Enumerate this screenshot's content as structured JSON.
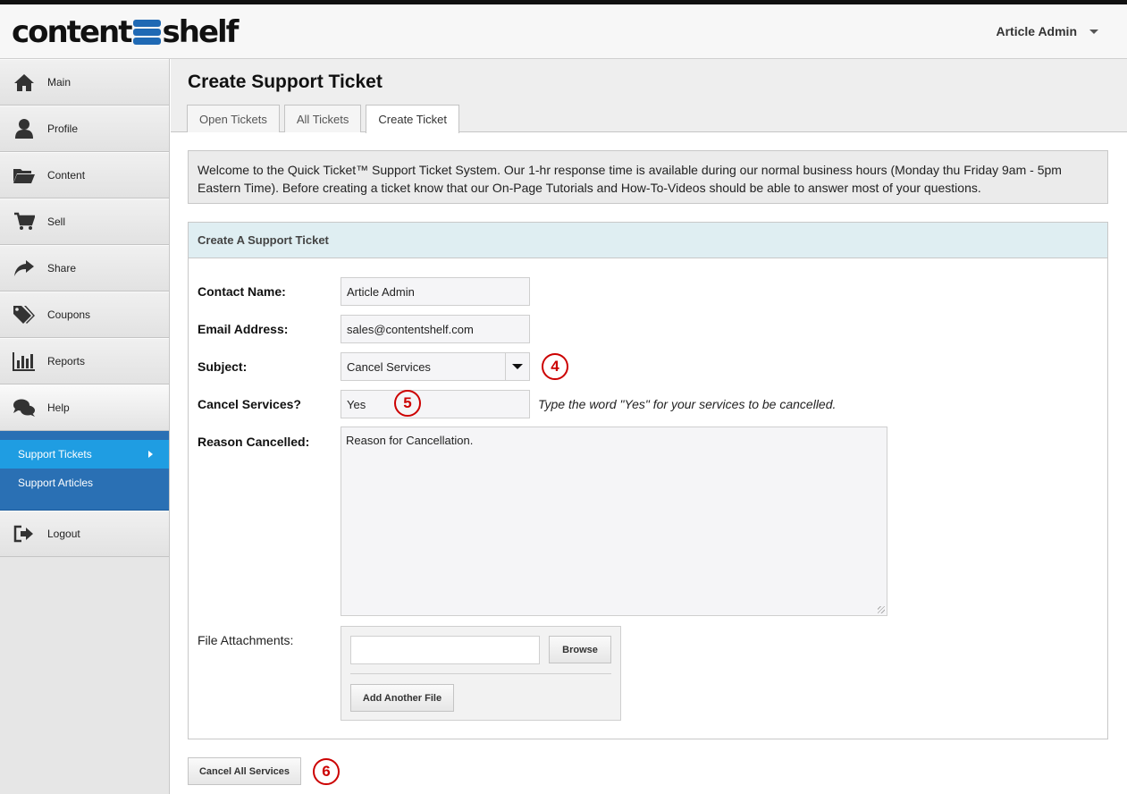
{
  "app": {
    "logo_left": "content",
    "logo_right": "shelf",
    "user_name": "Article Admin"
  },
  "sidebar": {
    "items": [
      {
        "label": "Main",
        "icon": "home-icon"
      },
      {
        "label": "Profile",
        "icon": "user-icon"
      },
      {
        "label": "Content",
        "icon": "folder-icon"
      },
      {
        "label": "Sell",
        "icon": "cart-icon"
      },
      {
        "label": "Share",
        "icon": "share-icon"
      },
      {
        "label": "Coupons",
        "icon": "tags-icon"
      },
      {
        "label": "Reports",
        "icon": "bar-chart-icon"
      },
      {
        "label": "Help",
        "icon": "chat-icon"
      }
    ],
    "subitems": [
      {
        "label": "Support Tickets",
        "selected": true
      },
      {
        "label": "Support Articles",
        "selected": false
      }
    ],
    "logout": {
      "label": "Logout",
      "icon": "logout-icon"
    }
  },
  "page": {
    "title": "Create Support Ticket",
    "tabs": [
      {
        "label": "Open Tickets",
        "active": false
      },
      {
        "label": "All Tickets",
        "active": false
      },
      {
        "label": "Create Ticket",
        "active": true
      }
    ],
    "welcome": "Welcome to the Quick Ticket™ Support Ticket System. Our 1-hr response time is available during our normal business hours (Monday thu Friday 9am - 5pm Eastern Time). Before creating a ticket know that our On-Page Tutorials and How-To-Videos should be able to answer most of your questions."
  },
  "form": {
    "heading": "Create A Support Ticket",
    "contact_label": "Contact Name:",
    "contact_value": "Article Admin",
    "email_label": "Email Address:",
    "email_value": "sales@contentshelf.com",
    "subject_label": "Subject:",
    "subject_value": "Cancel Services",
    "cancel_label": "Cancel Services?",
    "cancel_value": "Yes",
    "cancel_hint": "Type the word \"Yes\" for your services to be cancelled.",
    "reason_label": "Reason Cancelled:",
    "reason_value": "Reason for Cancellation.",
    "attach_label": "File Attachments:",
    "browse_label": "Browse",
    "add_file_label": "Add Another File",
    "submit_label": "Cancel All Services"
  },
  "annotations": {
    "subject_marker": "4",
    "cancel_marker": "5",
    "submit_marker": "6",
    "color": "#cc0000"
  }
}
